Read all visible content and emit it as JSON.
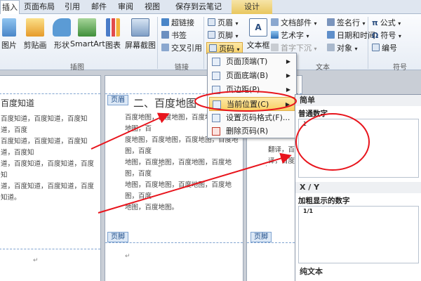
{
  "tabs": [
    {
      "label": "插入",
      "active": true
    },
    {
      "label": "页面布局"
    },
    {
      "label": "引用"
    },
    {
      "label": "邮件"
    },
    {
      "label": "审阅"
    },
    {
      "label": "视图"
    },
    {
      "label": "保存到云笔记"
    },
    {
      "label": "设计"
    }
  ],
  "ribbon": {
    "illustrations": {
      "buttons": [
        "图片",
        "剪贴画",
        "形状",
        "SmartArt",
        "图表",
        "屏幕截图"
      ],
      "group_label": "插图"
    },
    "links": {
      "buttons": [
        "超链接",
        "书签",
        "交叉引用"
      ],
      "group_label": "链接"
    },
    "header_footer": {
      "buttons": [
        "页眉",
        "页脚",
        "页码"
      ]
    },
    "text": {
      "textbox_label": "文本框",
      "buttons": [
        "文档部件",
        "艺术字",
        "首字下沉",
        "签名行",
        "日期和时间",
        "对象"
      ],
      "group_label": "文本"
    },
    "symbols": {
      "buttons": [
        "公式",
        "符号",
        "编号"
      ],
      "group_label": "符号"
    }
  },
  "menu": {
    "items": [
      {
        "label": "页面顶端(T)",
        "has_submenu": true
      },
      {
        "label": "页面底端(B)",
        "has_submenu": true
      },
      {
        "label": "页边距(P)",
        "has_submenu": true
      },
      {
        "label": "当前位置(C)",
        "has_submenu": true,
        "highlighted": true
      },
      {
        "label": "设置页码格式(F)...",
        "has_submenu": false
      },
      {
        "label": "删除页码(R)",
        "has_submenu": false
      }
    ]
  },
  "gallery": {
    "sections": [
      {
        "title": "简单",
        "subtitle": "普通数字",
        "sample": "1"
      },
      {
        "title": "X / Y",
        "subtitle": "加粗显示的数字",
        "sample": "1/1"
      },
      {
        "title": "纯文本"
      }
    ]
  },
  "document": {
    "page1": {
      "title": "百度知道",
      "lines": [
        "百度知道，百度知道，百度知道，百度",
        "百度知道，百度知道，百度知道，百度知",
        "道，百度知道，百度知道，百度知",
        "道，百度知道，百度知道，百度知道。"
      ]
    },
    "page2": {
      "title": "二、百度地图",
      "header_tag": "页眉",
      "footer_tag": "页脚",
      "lines": [
        "百度地图，百度地图，百度地图，百度地图，百",
        "度地图，百度地图，百度地图，百度地图，百度",
        "地图，百度地图，百度地图，百度地图，百度",
        "地图，百度地图，百度地图，百度地图，百度",
        "地图，百度地图。"
      ]
    },
    "page3": {
      "footer_tag": "页脚",
      "lines": [
        "翻译，百",
        "译，百度"
      ]
    }
  },
  "colors": {
    "annotation": "#e8141c",
    "highlight": "#f8cf63"
  }
}
